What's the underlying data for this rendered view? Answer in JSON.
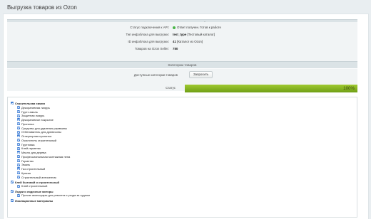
{
  "page": {
    "title": "Выгрузка товаров из Ozon"
  },
  "prep": {
    "header": "Подготовка выгрузки с Ozon Seller",
    "rows": [
      {
        "label": "Статус подключения к API:",
        "value": "Ответ получен. Готов к работе"
      },
      {
        "label": "Тип инфоблока для выгрузки:",
        "value_bold": "test_type",
        "value": "[Тестовый каталог]"
      },
      {
        "label": "ID инфоблока для выгрузки:",
        "value_bold": "41",
        "value": "[Каталог из Ozon]"
      },
      {
        "label": "Товаров на Ozon Seller:",
        "value_bold": "780",
        "value": ""
      }
    ]
  },
  "categories_section": {
    "header": "Категории товаров",
    "available_label": "Доступные категории товаров",
    "request_button": "Запросить",
    "status_label": "Статус",
    "progress": {
      "value": 100,
      "text": "100%"
    }
  },
  "tree": [
    {
      "label": "Строительная химия",
      "level": 0
    },
    {
      "label": "Декоративная лазурь",
      "level": 1
    },
    {
      "label": "Грунт-эмаль",
      "level": 1
    },
    {
      "label": "Защитная лазурь",
      "level": 1
    },
    {
      "label": "Декоративное покрытие",
      "level": 1
    },
    {
      "label": "Пропитка",
      "level": 1
    },
    {
      "label": "Средство для удаления ржавчины",
      "level": 1
    },
    {
      "label": "Отбеливатель для древесины",
      "level": 1
    },
    {
      "label": "Огнеупорная пропитка",
      "level": 1
    },
    {
      "label": "Очиститель строительный",
      "level": 1
    },
    {
      "label": "Грунтовка",
      "level": 1
    },
    {
      "label": "Клей-герметик",
      "level": 1
    },
    {
      "label": "Масло для дерева",
      "level": 1
    },
    {
      "label": "Профессиональная монтажная пена",
      "level": 1
    },
    {
      "label": "Герметик",
      "level": 1
    },
    {
      "label": "Эмаль",
      "level": 1
    },
    {
      "label": "Газ строительный",
      "level": 1
    },
    {
      "label": "Краска",
      "level": 1
    },
    {
      "label": "Строительный антисептик",
      "level": 1
    },
    {
      "label": "Клей бытовой и строительный",
      "level": 0
    },
    {
      "label": "Клей строительный",
      "level": 1
    },
    {
      "label": "Лодки и лодочные моторы",
      "level": 0
    },
    {
      "label": "Прочие аксессуары для ремонта и ухода за судном",
      "level": 1
    },
    {
      "label": "Изоляционные материалы",
      "level": 0
    }
  ],
  "colors": {
    "accent_green": "#8cb82a",
    "checkbox_blue": "#3a7bd5",
    "status_ok": "#49b547"
  },
  "icons": {
    "status": "green-dot-icon",
    "checkbox": "checkbox-checked-icon"
  }
}
